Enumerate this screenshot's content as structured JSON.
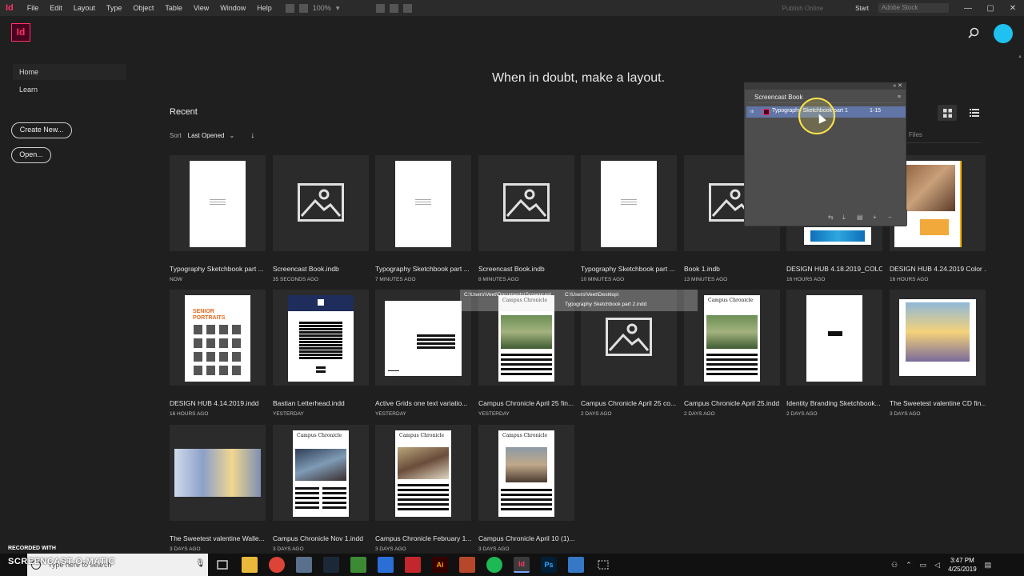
{
  "menubar": {
    "app_id": "Id",
    "menus": [
      "File",
      "Edit",
      "Layout",
      "Type",
      "Object",
      "Table",
      "View",
      "Window",
      "Help"
    ],
    "zoom": "100%",
    "publish": "Publish Online",
    "workspace": "Start",
    "stock_placeholder": "Adobe Stock"
  },
  "appbar": {
    "logo": "Id"
  },
  "sidebar": {
    "nav": [
      "Home",
      "Learn"
    ],
    "create_button": "Create New...",
    "open_button": "Open..."
  },
  "main": {
    "tagline": "When in doubt, make a layout.",
    "recent_title": "Recent",
    "sort_label": "Sort",
    "sort_value": "Last Opened",
    "files_tab": "Files"
  },
  "files": [
    {
      "name": "Typography Sketchbook part ...",
      "time": "NOW",
      "thumb": "blank"
    },
    {
      "name": "Screencast Book.indb",
      "time": "35 SECONDS AGO",
      "thumb": "image"
    },
    {
      "name": "Typography Sketchbook part ...",
      "time": "7 MINUTES AGO",
      "thumb": "blank"
    },
    {
      "name": "Screencast Book.indb",
      "time": "8 MINUTES AGO",
      "thumb": "image"
    },
    {
      "name": "Typography Sketchbook part ...",
      "time": "10 MINUTES AGO",
      "thumb": "blank"
    },
    {
      "name": "Book 1.indb",
      "time": "13 MINUTES AGO",
      "thumb": "image"
    },
    {
      "name": "DESIGN HUB 4.18.2019_COLO...",
      "time": "16 HOURS AGO",
      "thumb": "hub"
    },
    {
      "name": "DESIGN HUB 4.24.2019 Color ...",
      "time": "16 HOURS AGO",
      "thumb": "hub2"
    },
    {
      "name": "DESIGN HUB 4.14.2019.indd",
      "time": "16 HOURS AGO",
      "thumb": "portraits"
    },
    {
      "name": "Bastian Letterhead.indd",
      "time": "YESTERDAY",
      "thumb": "letterhead"
    },
    {
      "name": "Active Grids one text variatio...",
      "time": "YESTERDAY",
      "thumb": "grids"
    },
    {
      "name": "Campus Chronicle April 25 fin...",
      "time": "YESTERDAY",
      "thumb": "newspaper"
    },
    {
      "name": "Campus Chronicle April 25 co...",
      "time": "2 DAYS AGO",
      "thumb": "image"
    },
    {
      "name": "Campus Chronicle April 25.indd",
      "time": "2 DAYS AGO",
      "thumb": "newspaper"
    },
    {
      "name": "Identity Branding Sketchbook...",
      "time": "2 DAYS AGO",
      "thumb": "identity"
    },
    {
      "name": "The Sweetest valentine CD fin...",
      "time": "3 DAYS AGO",
      "thumb": "valentine"
    },
    {
      "name": "The Sweetest valentine Walle...",
      "time": "3 DAYS AGO",
      "thumb": "wallet"
    },
    {
      "name": "Campus Chronicle Nov 1.indd",
      "time": "3 DAYS AGO",
      "thumb": "newspaper2"
    },
    {
      "name": "Campus Chronicle February 1...",
      "time": "3 DAYS AGO",
      "thumb": "newspaper3"
    },
    {
      "name": "Campus Chronicle April 10 (1)....",
      "time": "3 DAYS AGO",
      "thumb": "newspaper4"
    }
  ],
  "book_panel": {
    "title": "Screencast Book",
    "row_name": "Typography Sketchbook part 1",
    "row_pages": "1-15"
  },
  "tooltip": {
    "path1": "C:\\Users\\Veet\\Documents\\Screencast",
    "path2": "C:\\Users\\Veet\\Desktop\\",
    "file": "Typography Sketchbook part 2.indd"
  },
  "taskbar": {
    "search_placeholder": "Type here to search",
    "time": "3:47 PM",
    "date": "4/25/2019"
  },
  "watermark": {
    "line1": "RECORDED WITH",
    "line2": "SCREENCAST-O-MATIC"
  },
  "colors": {
    "accent": "#ff3366",
    "profile": "#1ec1f0",
    "panel_select": "#6176a6",
    "cursor_ring": "#ffe44a"
  }
}
